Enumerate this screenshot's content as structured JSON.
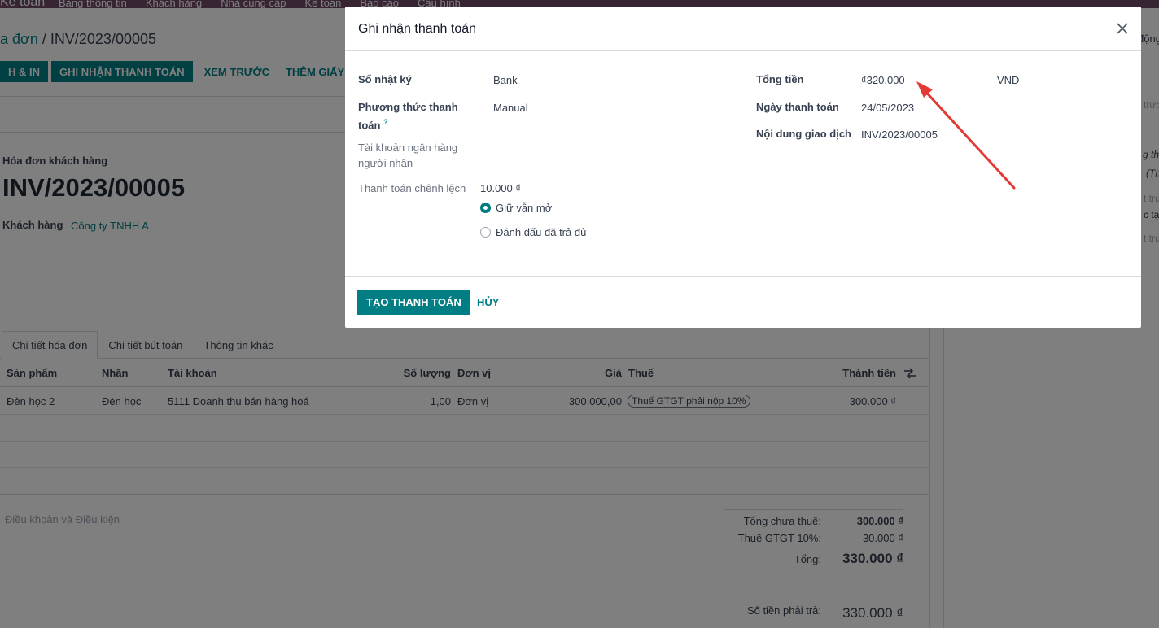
{
  "app": {
    "brand": "Kế toán",
    "menu": [
      "Bảng thông tin",
      "Khách hàng",
      "Nhà cung cấp",
      "Kế toán",
      "Báo cáo",
      "Cấu hình"
    ]
  },
  "breadcrumb": {
    "parent": "a đơn",
    "sep": "/",
    "current": "INV/2023/00005"
  },
  "actions": {
    "print": "H & IN",
    "register_payment": "GHI NHẬN THANH TOÁN",
    "preview": "XEM TRƯỚC",
    "add_credit": "THÊM GIẤY BÁO"
  },
  "invoice": {
    "type": "Hóa đơn khách hàng",
    "number": "INV/2023/00005",
    "customer_label": "Khách hàng",
    "customer": "Công ty TNHH A"
  },
  "tabs": [
    "Chi tiết hóa đơn",
    "Chi tiết bút toán",
    "Thông tin khác"
  ],
  "lines": {
    "headers": {
      "product": "Sản phẩm",
      "label": "Nhãn",
      "account": "Tài khoản",
      "qty": "Số lượng",
      "uom": "Đơn vị",
      "price": "Giá",
      "tax": "Thuế",
      "subtotal": "Thành tiền"
    },
    "rows": [
      {
        "product": "Đèn học 2",
        "label": "Đèn học",
        "account": "5111 Doanh thu bán hàng hoá",
        "qty": "1,00",
        "uom": "Đơn vị",
        "price": "300.000,00",
        "tax": "Thuế GTGT phải nộp 10%",
        "subtotal": "300.000 ₫"
      }
    ]
  },
  "terms_placeholder": "Điều khoản và Điều kiện",
  "totals": {
    "untaxed_label": "Tổng chưa thuế:",
    "untaxed": "300.000 ₫",
    "tax_label": "Thuế GTGT 10%:",
    "tax": "30.000 ₫",
    "total_label": "Tổng:",
    "total": "330.000 ₫",
    "due_label": "Số tiền phải trả:",
    "due": "330.000 ₫"
  },
  "chatter_fragments": [
    "động",
    "trướ",
    "g th",
    "(Th",
    "t tru",
    "c tạ",
    "t tru"
  ],
  "modal": {
    "title": "Ghi nhận thanh toán",
    "journal_label": "Sổ nhật ký",
    "journal": "Bank",
    "method_label_1": "Phương thức thanh",
    "method_label_2": "toán",
    "method_help": "?",
    "method": "Manual",
    "recipient_label_1": "Tài khoản ngân hàng",
    "recipient_label_2": "người nhận",
    "diff_label": "Thanh toán chênh lệch",
    "diff": "10.000 ₫",
    "opt_keep_open": "Giữ vẫn mở",
    "opt_mark_paid": "Đánh dấu đã trả đủ",
    "amount_label": "Tổng tiền",
    "amount": "₫320.000",
    "currency": "VND",
    "date_label": "Ngày thanh toán",
    "date": "24/05/2023",
    "memo_label": "Nội dung giao dịch",
    "memo": "INV/2023/00005",
    "create_btn": "TẠO THANH TOÁN",
    "cancel_btn": "HỦY"
  },
  "colors": {
    "primary": "#017e84",
    "navbar": "#714B67",
    "annotation_arrow": "#e53935"
  }
}
